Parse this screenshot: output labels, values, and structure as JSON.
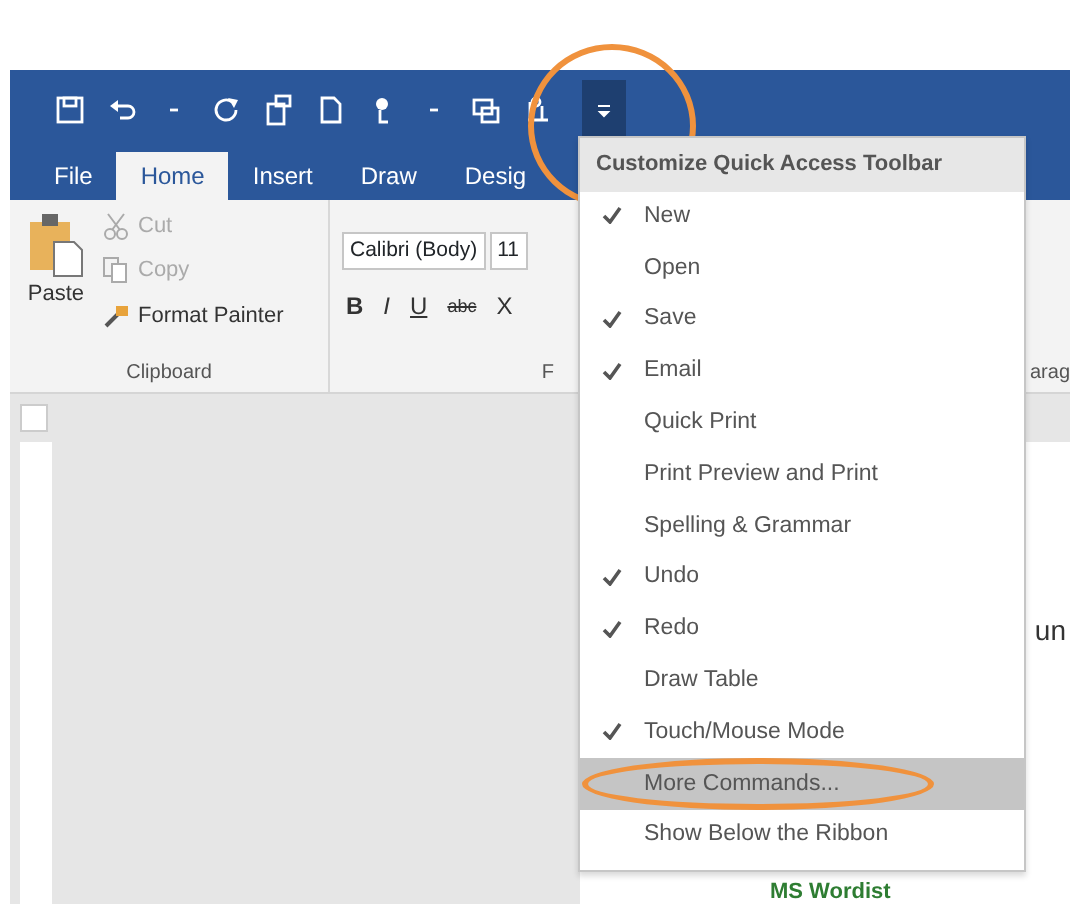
{
  "tabs": [
    {
      "label": "File",
      "selected": false
    },
    {
      "label": "Home",
      "selected": true
    },
    {
      "label": "Insert",
      "selected": false
    },
    {
      "label": "Draw",
      "selected": false
    },
    {
      "label": "Desig",
      "selected": false
    }
  ],
  "clipboard": {
    "paste": "Paste",
    "items": [
      {
        "label": "Cut",
        "disabled": true
      },
      {
        "label": "Copy",
        "disabled": true
      },
      {
        "label": "Format Painter",
        "disabled": false
      }
    ],
    "group_label": "Clipboard"
  },
  "font": {
    "name": "Calibri (Body)",
    "size": "11",
    "buttons": [
      "B",
      "I",
      "U",
      "abc",
      "X"
    ],
    "group_label": "F"
  },
  "paragraph_group_label": "arag",
  "document": {
    "text_1": "un",
    "heading": "MS Wordist"
  },
  "menu": {
    "title": "Customize Quick Access Toolbar",
    "items": [
      {
        "label": "New",
        "checked": true,
        "selected": false
      },
      {
        "label": "Open",
        "checked": false,
        "selected": false
      },
      {
        "label": "Save",
        "checked": true,
        "selected": false
      },
      {
        "label": "Email",
        "checked": true,
        "selected": false
      },
      {
        "label": "Quick Print",
        "checked": false,
        "selected": false
      },
      {
        "label": "Print Preview and Print",
        "checked": false,
        "selected": false
      },
      {
        "label": "Spelling & Grammar",
        "checked": false,
        "selected": false
      },
      {
        "label": "Undo",
        "checked": true,
        "selected": false
      },
      {
        "label": "Redo",
        "checked": true,
        "selected": false
      },
      {
        "label": "Draw Table",
        "checked": false,
        "selected": false
      },
      {
        "label": "Touch/Mouse Mode",
        "checked": true,
        "selected": false
      },
      {
        "label": "More Commands...",
        "checked": false,
        "selected": true
      },
      {
        "label": "Show Below the Ribbon",
        "checked": false,
        "selected": false
      }
    ]
  }
}
